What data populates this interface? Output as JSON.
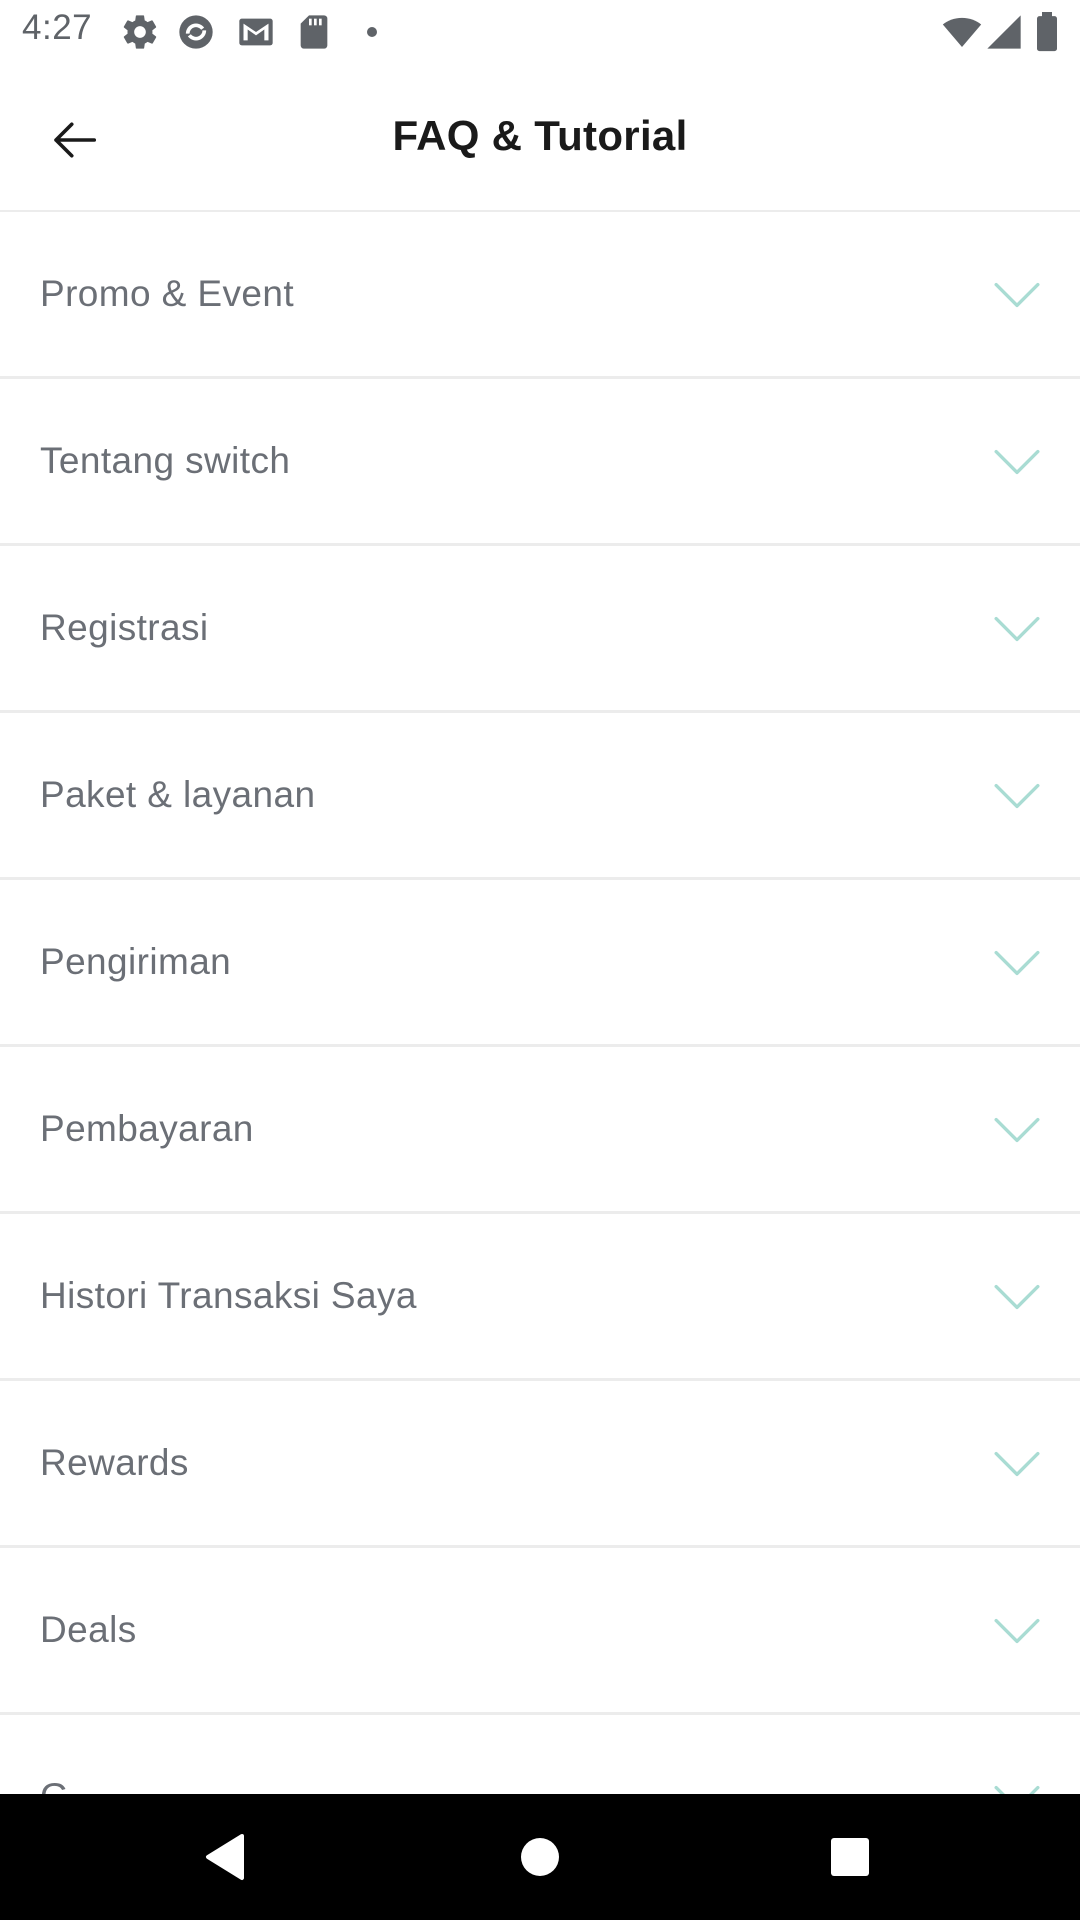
{
  "status_bar": {
    "time": "4:27",
    "icons_left": [
      "gear-icon",
      "sync-app-icon",
      "gmail-icon",
      "sd-card-icon",
      "dot-icon"
    ],
    "icons_right": [
      "wifi-icon",
      "signal-icon",
      "battery-icon"
    ]
  },
  "header": {
    "title": "FAQ & Tutorial",
    "back_icon": "arrow-left-icon"
  },
  "faq": {
    "items": [
      {
        "label": "Promo & Event"
      },
      {
        "label": "Tentang switch"
      },
      {
        "label": "Registrasi"
      },
      {
        "label": "Paket & layanan"
      },
      {
        "label": "Pengiriman"
      },
      {
        "label": "Pembayaran"
      },
      {
        "label": "Histori Transaksi Saya"
      },
      {
        "label": "Rewards"
      },
      {
        "label": "Deals"
      },
      {
        "label": "G"
      }
    ],
    "chevron_icon": "chevron-down-icon"
  },
  "colors": {
    "chevron": "#a9dcd3",
    "label_text": "#6b6f76",
    "title_text": "#1a1a1a",
    "divider": "#ececec"
  },
  "nav_bar": {
    "buttons": [
      "back-triangle-icon",
      "home-circle-icon",
      "recents-square-icon"
    ]
  }
}
